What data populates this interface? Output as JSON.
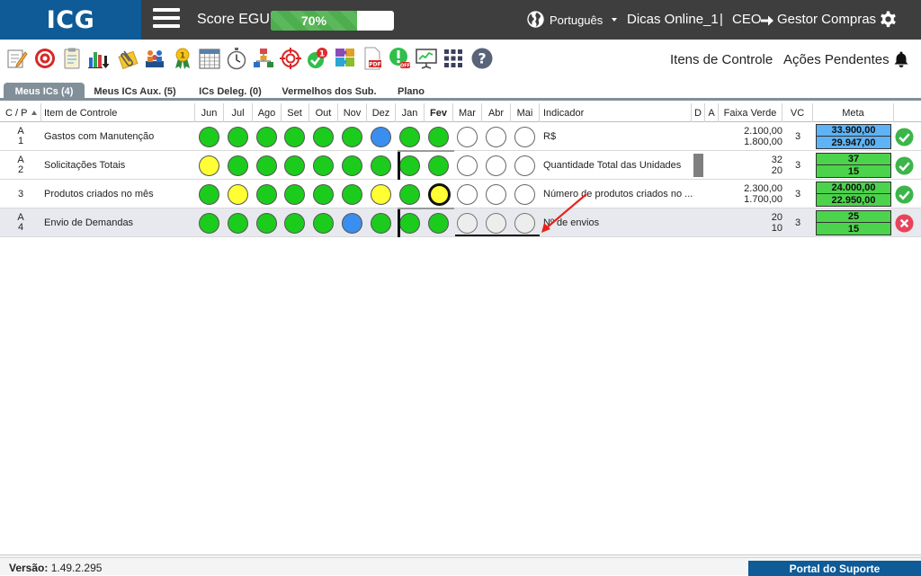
{
  "header": {
    "logo": "ICG",
    "score_label": "Score EGU:",
    "score_value": "70%",
    "score_percent": 70,
    "language": "Português",
    "user": "Dicas Online_1",
    "separator": "|",
    "role_from": "CEO",
    "role_to": "Gestor Compras"
  },
  "toolbar": {
    "icons": [
      "edit-notepad-icon",
      "target-icon",
      "clipboard-icon",
      "bar-chart-download-icon",
      "paperclip-icon",
      "team-meeting-icon",
      "award-ribbon-icon",
      "calendar-grid-icon",
      "stopwatch-icon",
      "org-chart-icon",
      "crosshair-icon",
      "checkmark-badge-icon",
      "puzzle-icon",
      "pdf-file-icon",
      "alert-off-icon",
      "presentation-icon",
      "apps-grid-icon",
      "help-icon"
    ],
    "notification_badge": "1",
    "itens_label": "Itens de Controle",
    "acoes_label": "Ações Pendentes"
  },
  "tabs": [
    {
      "label": "Meus ICs (4)",
      "active": true
    },
    {
      "label": "Meus ICs Aux. (5)",
      "active": false
    },
    {
      "label": "ICs Deleg. (0)",
      "active": false
    },
    {
      "label": "Vermelhos dos Sub.",
      "active": false
    },
    {
      "label": "Plano",
      "active": false
    }
  ],
  "table": {
    "headers": {
      "cp": "C / P",
      "item": "Item de Controle",
      "months": [
        "Jun",
        "Jul",
        "Ago",
        "Set",
        "Out",
        "Nov",
        "Dez",
        "Jan",
        "Fev",
        "Mar",
        "Abr",
        "Mai"
      ],
      "indicador": "Indicador",
      "d": "D",
      "a": "A",
      "faixa": "Faixa Verde",
      "vc": "VC",
      "meta": "Meta"
    },
    "rows": [
      {
        "cp_top": "A",
        "cp_bot": "1",
        "item": "Gastos com Manutenção",
        "months": [
          "green",
          "green",
          "green",
          "green",
          "green",
          "green",
          "blue",
          "green",
          "green",
          "empty",
          "empty",
          "empty"
        ],
        "indicador": "R$",
        "faixa_top": "2.100,00",
        "faixa_bot": "1.800,00",
        "vc": "3",
        "meta_top": "33.900,00",
        "meta_bot": "29.947,00",
        "meta_color": "blue",
        "status": "ok"
      },
      {
        "cp_top": "A",
        "cp_bot": "2",
        "item": "Solicitações Totais",
        "months": [
          "yellow",
          "green",
          "green",
          "green",
          "green",
          "green",
          "green",
          "green",
          "green",
          "empty",
          "empty",
          "empty"
        ],
        "indicador": "Quantidade Total das Unidades",
        "faixa_top": "32",
        "faixa_bot": "20",
        "vc": "3",
        "meta_top": "37",
        "meta_bot": "15",
        "meta_color": "green",
        "status": "ok"
      },
      {
        "cp_top": "",
        "cp_bot": "3",
        "item": "Produtos criados no mês",
        "months": [
          "green",
          "yellow",
          "green",
          "green",
          "green",
          "green",
          "yellow",
          "green",
          "yellow-thick",
          "empty",
          "empty",
          "empty"
        ],
        "indicador": "Número de produtos criados no ...",
        "faixa_top": "2.300,00",
        "faixa_bot": "1.700,00",
        "vc": "3",
        "meta_top": "24.000,00",
        "meta_bot": "22.950,00",
        "meta_color": "green",
        "status": "ok"
      },
      {
        "cp_top": "A",
        "cp_bot": "4",
        "item": "Envio de Demandas",
        "months": [
          "green",
          "green",
          "green",
          "green",
          "green",
          "blue",
          "green",
          "green",
          "green",
          "grey",
          "grey",
          "grey"
        ],
        "indicador": "Nº de envios",
        "faixa_top": "20",
        "faixa_bot": "10",
        "vc": "3",
        "meta_top": "25",
        "meta_bot": "15",
        "meta_color": "green",
        "status": "fail"
      }
    ]
  },
  "footer": {
    "version_label": "Versão:",
    "version_value": "1.49.2.295",
    "portal": "Portal do Suporte"
  },
  "colors": {
    "logo_bg": "#0e5b97",
    "topbar_bg": "#3e3e3e",
    "green": "#1ccc1c",
    "yellow": "#ffff33",
    "blue": "#3a8ef0",
    "ok": "#3cb54a",
    "fail": "#e8435a"
  }
}
